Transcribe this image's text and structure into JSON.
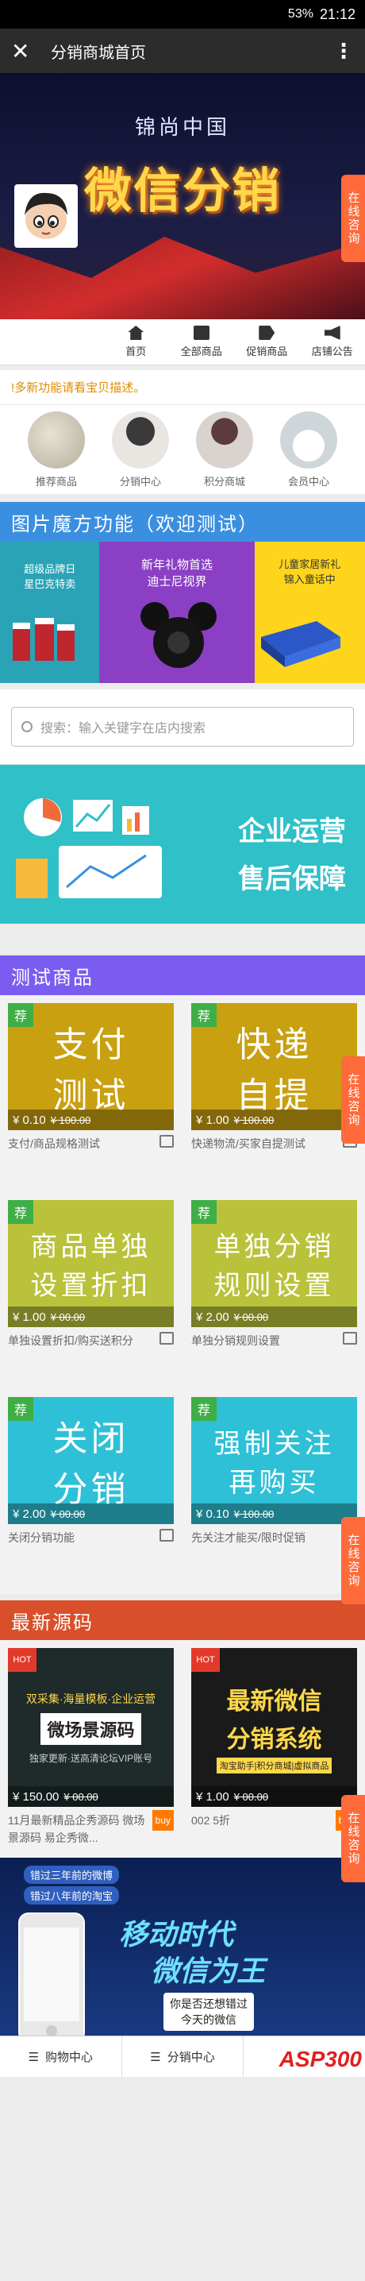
{
  "status": {
    "battery": "53%",
    "time": "21:12"
  },
  "appbar": {
    "close_icon": "close-icon",
    "title": "分销商城首页",
    "more_icon": "more-vertical-icon"
  },
  "banner": {
    "subtitle": "锦尚中国",
    "headline": "微信分销"
  },
  "nav": [
    {
      "label": "首页",
      "icon": "home-icon"
    },
    {
      "label": "全部商品",
      "icon": "bag-icon"
    },
    {
      "label": "促销商品",
      "icon": "tag-icon"
    },
    {
      "label": "店铺公告",
      "icon": "speaker-icon"
    }
  ],
  "side_tab": "在线咨询",
  "notice": "!多新功能请看宝贝描述。",
  "circles": [
    "推荐商品",
    "分销中心",
    "积分商城",
    "会员中心"
  ],
  "magic_section": {
    "title": "图片魔方功能（欢迎测试）",
    "color": "#3b8fe0"
  },
  "magic": [
    {
      "line1": "超级品牌日",
      "line2": "星巴克特卖",
      "bg": "#2aa3b7"
    },
    {
      "line1": "新年礼物首选",
      "line2": "迪士尼视界",
      "bg": "#8a3fc4"
    },
    {
      "line1": "儿童家居新礼",
      "line2": "锦入童话中",
      "bg": "#ffd51c"
    }
  ],
  "search": {
    "placeholder": "搜索：输入关键字在店内搜索"
  },
  "promo": {
    "line1": "企业运营",
    "line2": "售后保障"
  },
  "test_section": {
    "title": "测试商品",
    "color": "#7a5cf0"
  },
  "products": [
    {
      "badge": "荐",
      "art1": "支付",
      "art2": "测试",
      "price": "¥ 0.10",
      "old": "¥ 100.00",
      "desc": "支付/商品规格测试",
      "bg": "#c8a010"
    },
    {
      "badge": "荐",
      "art1": "快递",
      "art2": "自提",
      "price": "¥ 1.00",
      "old": "¥ 100.00",
      "desc": "快递物流/买家自提测试",
      "bg": "#c8a010"
    },
    {
      "badge": "荐",
      "art1": "商品单独",
      "art2": "设置折扣",
      "price": "¥ 1.00",
      "old": "¥ 00.00",
      "desc": "单独设置折扣/购买送积分",
      "bg": "#b9c23a"
    },
    {
      "badge": "荐",
      "art1": "单独分销",
      "art2": "规则设置",
      "price": "¥ 2.00",
      "old": "¥ 00.00",
      "desc": "单独分销规则设置",
      "bg": "#b9c23a"
    },
    {
      "badge": "荐",
      "art1": "关闭",
      "art2": "分销",
      "price": "¥ 2.00",
      "old": "¥ 00.00",
      "desc": "关闭分销功能",
      "bg": "#2ec0d6"
    },
    {
      "badge": "荐",
      "art1": "强制关注",
      "art2": "再购买",
      "price": "¥ 0.10",
      "old": "¥ 100.00",
      "desc": "先关注才能买/限时促销",
      "bg": "#2ec0d6"
    }
  ],
  "source_section": {
    "title": "最新源码",
    "color": "#d94f2a"
  },
  "sources": [
    {
      "hot": "HOT",
      "line1": "双采集·海量模板·企业运营",
      "line2": "微场景源码",
      "line3": "独家更新·送高清论坛VIP账号",
      "price": "¥ 150.00",
      "old": "¥ 00.00",
      "desc": "11月最新精品企秀源码 微场景源码 易企秀微...",
      "buy": "buy",
      "bg": "#1f2a2a"
    },
    {
      "hot": "HOT",
      "line1": "最新微信",
      "line2": "分销系统",
      "line3": "淘宝助手|积分商城|虚拟商品",
      "price": "¥ 1.00",
      "old": "¥ 00.00",
      "desc": "002 5折",
      "buy": "buy",
      "bg": "#1a1a1a"
    }
  ],
  "bottom_banner": {
    "tag1": "错过三年前的微博",
    "tag2": "错过八年前的淘宝",
    "line1": "移动时代",
    "line2": "微信为王",
    "q1": "你是否还想错过",
    "q2": "今天的微信"
  },
  "bottombar": [
    {
      "label": "购物中心",
      "icon": "list-icon"
    },
    {
      "label": "分销中心",
      "icon": "list-icon"
    }
  ],
  "watermark": "ASP300"
}
